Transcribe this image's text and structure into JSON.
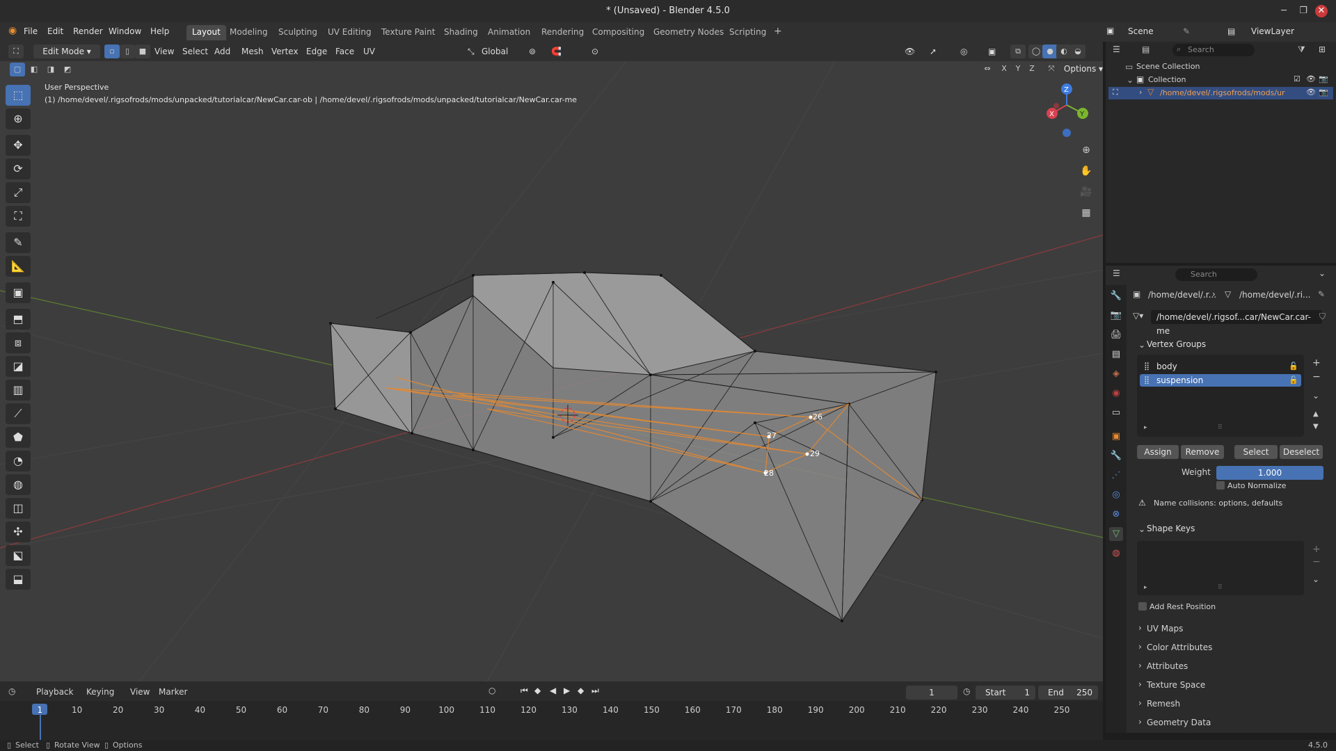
{
  "window": {
    "title": "* (Unsaved) - Blender 4.5.0"
  },
  "menu": [
    "File",
    "Edit",
    "Render",
    "Window",
    "Help"
  ],
  "workspaces": [
    "Layout",
    "Modeling",
    "Sculpting",
    "UV Editing",
    "Texture Paint",
    "Shading",
    "Animation",
    "Rendering",
    "Compositing",
    "Geometry Nodes",
    "Scripting"
  ],
  "active_workspace": "Layout",
  "scene": {
    "name": "Scene",
    "view_layer": "ViewLayer"
  },
  "viewport_header": {
    "mode": "Edit Mode",
    "menus": [
      "View",
      "Select",
      "Add",
      "Mesh",
      "Vertex",
      "Edge",
      "Face",
      "UV"
    ],
    "orientation": "Global",
    "axes": [
      "X",
      "Y",
      "Z"
    ],
    "options_label": "Options"
  },
  "viewport": {
    "perspective": "User Perspective",
    "object_info": "(1) /home/devel/.rigsofrods/mods/unpacked/tutorialcar/NewCar.car-ob | /home/devel/.rigsofrods/mods/unpacked/tutorialcar/NewCar.car-me",
    "vertex_labels": [
      "26",
      "27",
      "29",
      "28"
    ],
    "gizmo_axes": [
      "X",
      "Y",
      "Z"
    ]
  },
  "outliner": {
    "search_placeholder": "Search",
    "scene_collection": "Scene Collection",
    "collection": "Collection",
    "object": "/home/devel/.rigsofrods/mods/ur"
  },
  "properties": {
    "search_placeholder": "Search",
    "breadcrumb": [
      "/home/devel/.r...",
      "/home/devel/.ri..."
    ],
    "mesh_name": "/home/devel/.rigsof...car/NewCar.car-me",
    "vertex_groups_title": "Vertex Groups",
    "vertex_groups": [
      {
        "name": "body",
        "selected": false
      },
      {
        "name": "suspension",
        "selected": true
      }
    ],
    "buttons": {
      "assign": "Assign",
      "remove": "Remove",
      "select": "Select",
      "deselect": "Deselect"
    },
    "weight_label": "Weight",
    "weight_value": "1.000",
    "auto_normalize": "Auto Normalize",
    "warning": "Name collisions: options, defaults",
    "shape_keys_title": "Shape Keys",
    "add_rest_position": "Add Rest Position",
    "collapsed_sections": [
      "UV Maps",
      "Color Attributes",
      "Attributes",
      "Texture Space",
      "Remesh",
      "Geometry Data"
    ]
  },
  "timeline": {
    "menus": [
      "Playback",
      "Keying",
      "View",
      "Marker"
    ],
    "current_frame": "1",
    "start_label": "Start",
    "start_value": "1",
    "end_label": "End",
    "end_value": "250",
    "frame_ticks": [
      "1",
      "10",
      "20",
      "30",
      "40",
      "50",
      "60",
      "70",
      "80",
      "90",
      "100",
      "110",
      "120",
      "130",
      "140",
      "150",
      "160",
      "170",
      "180",
      "190",
      "200",
      "210",
      "220",
      "230",
      "240",
      "250"
    ]
  },
  "statusbar": {
    "select": "Select",
    "rotate": "Rotate View",
    "options": "Options",
    "version": "4.5.0"
  },
  "colors": {
    "accent": "#4772b3",
    "edge_selected": "#e8892f",
    "x_axis": "#d9414f",
    "y_axis": "#7bb52e",
    "z_axis": "#3d7be0"
  }
}
